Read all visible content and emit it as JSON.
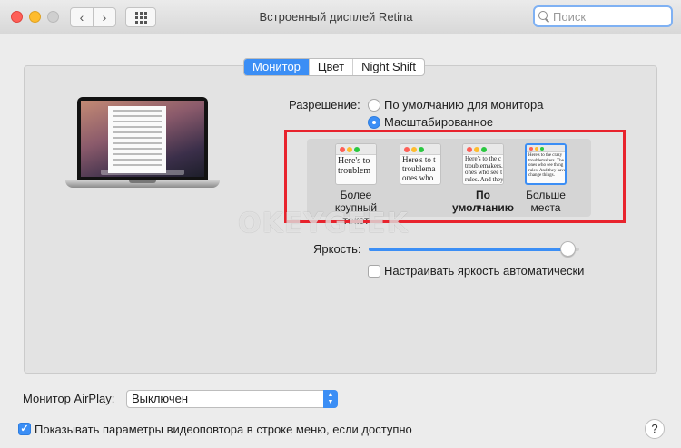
{
  "window": {
    "title": "Встроенный дисплей Retina",
    "nav_back": "‹",
    "nav_forward": "›",
    "search_placeholder": "Поиск"
  },
  "tabs": [
    {
      "label": "Монитор",
      "active": true
    },
    {
      "label": "Цвет",
      "active": false
    },
    {
      "label": "Night Shift",
      "active": false
    }
  ],
  "resolution": {
    "label": "Разрешение:",
    "options": [
      {
        "label": "По умолчанию для монитора",
        "selected": false
      },
      {
        "label": "Масштабированное",
        "selected": true
      }
    ],
    "scales": [
      {
        "preview": "Here's to\ntroublem",
        "label": "Более крупный текст",
        "bold": false,
        "selected": false
      },
      {
        "preview": "Here's to t\ntroublema\nones who",
        "label": "",
        "bold": false,
        "selected": false
      },
      {
        "preview": "Here's to the c\ntroublemakers.\nones who see t\nrules. And they",
        "label": "По умолчанию",
        "bold": true,
        "selected": false
      },
      {
        "preview": "Here's to the crazy\ntroublemakers. The\nones who see thing\nrules. And they have\nchange things.",
        "label": "Больше места",
        "bold": false,
        "selected": true
      }
    ]
  },
  "watermark": "OKEYGEEK",
  "brightness": {
    "label": "Яркость:",
    "value": 0.95,
    "auto_label": "Настраивать яркость автоматически",
    "auto_checked": false
  },
  "airplay": {
    "label": "Монитор AirPlay:",
    "value": "Выключен"
  },
  "mirroring": {
    "label": "Показывать параметры видеоповтора в строке меню, если доступно",
    "checked": true
  },
  "help_label": "?",
  "colors": {
    "accent": "#3b8ef5",
    "highlight_box": "#e8232d"
  }
}
